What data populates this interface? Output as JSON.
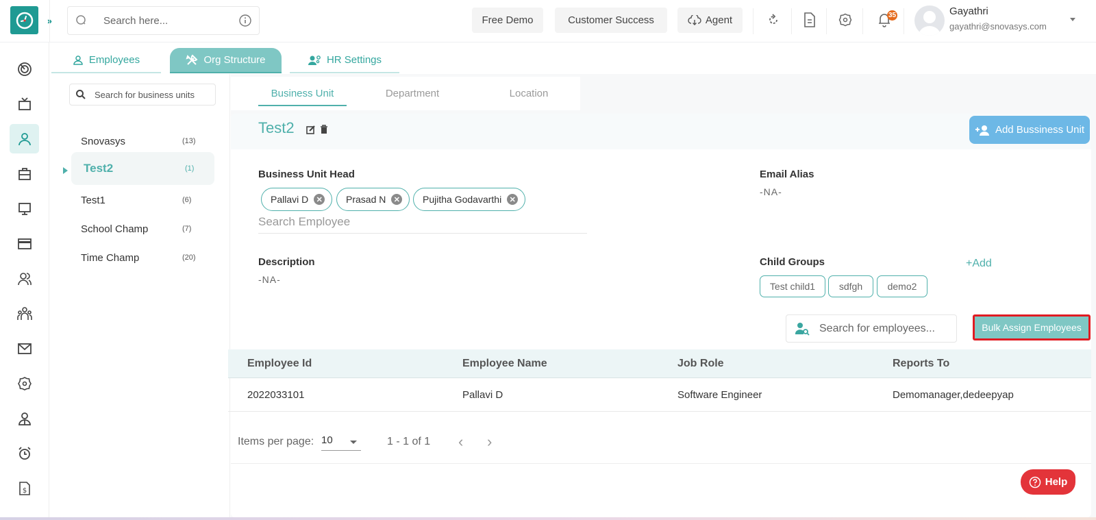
{
  "topbar": {
    "search_placeholder": "Search here...",
    "buttons": {
      "free_demo": "Free Demo",
      "customer_success": "Customer Success",
      "agent": "Agent"
    },
    "notification_count": "35",
    "user": {
      "name": "Gayathri",
      "email": "gayathri@snovasys.com"
    }
  },
  "sidebar": {
    "items": [
      {
        "icon": "dashboard-icon",
        "active": false
      },
      {
        "icon": "tv-icon",
        "active": false
      },
      {
        "icon": "user-icon",
        "active": true
      },
      {
        "icon": "briefcase-icon",
        "active": false
      },
      {
        "icon": "monitor-icon",
        "active": false
      },
      {
        "icon": "credit-card-icon",
        "active": false
      },
      {
        "icon": "users-icon",
        "active": false
      },
      {
        "icon": "team-icon",
        "active": false
      },
      {
        "icon": "mail-icon",
        "active": false
      },
      {
        "icon": "settings-icon",
        "active": false
      },
      {
        "icon": "profile-icon",
        "active": false
      },
      {
        "icon": "alarm-icon",
        "active": false
      },
      {
        "icon": "invoice-icon",
        "active": false
      }
    ]
  },
  "main_tabs": [
    {
      "label": "Employees",
      "active": false
    },
    {
      "label": "Org Structure",
      "active": true
    },
    {
      "label": "HR Settings",
      "active": false
    }
  ],
  "business_units": {
    "search_placeholder": "Search for business units",
    "items": [
      {
        "name": "Snovasys",
        "count": "(13)",
        "active": false
      },
      {
        "name": "Test2",
        "count": "(1)",
        "active": true
      },
      {
        "name": "Test1",
        "count": "(6)",
        "active": false
      },
      {
        "name": "School Champ",
        "count": "(7)",
        "active": false
      },
      {
        "name": "Time Champ",
        "count": "(20)",
        "active": false
      }
    ]
  },
  "sub_tabs": [
    {
      "label": "Business Unit",
      "active": true
    },
    {
      "label": "Department",
      "active": false
    },
    {
      "label": "Location",
      "active": false
    }
  ],
  "detail": {
    "title": "Test2",
    "add_button": "Add Bussiness Unit",
    "head_label": "Business Unit Head",
    "heads": [
      "Pallavi D",
      "Prasad N",
      "Pujitha Godavarthi"
    ],
    "search_employee_placeholder": "Search Employee",
    "email_alias_label": "Email Alias",
    "email_alias_value": "-NA-",
    "description_label": "Description",
    "description_value": "-NA-",
    "child_groups_label": "Child Groups",
    "child_groups_add": "+Add",
    "child_groups": [
      "Test child1",
      "sdfgh",
      "demo2"
    ],
    "employee_search_placeholder": "Search for employees...",
    "bulk_assign_button": "Bulk Assign Employees"
  },
  "table": {
    "columns": [
      "Employee Id",
      "Employee Name",
      "Job Role",
      "Reports To"
    ],
    "rows": [
      [
        "2022033101",
        "Pallavi D",
        "Software Engineer",
        "Demomanager,dedeepyap"
      ]
    ]
  },
  "pagination": {
    "items_per_page_label": "Items per page:",
    "items_per_page": "10",
    "range": "1 - 1 of 1"
  },
  "help_button": "Help",
  "colors": {
    "brand": "#1f9a93",
    "accent": "#4fb0ab",
    "add_button": "#6db8e6",
    "help": "#e3343a",
    "highlight_border": "#e11b22"
  }
}
